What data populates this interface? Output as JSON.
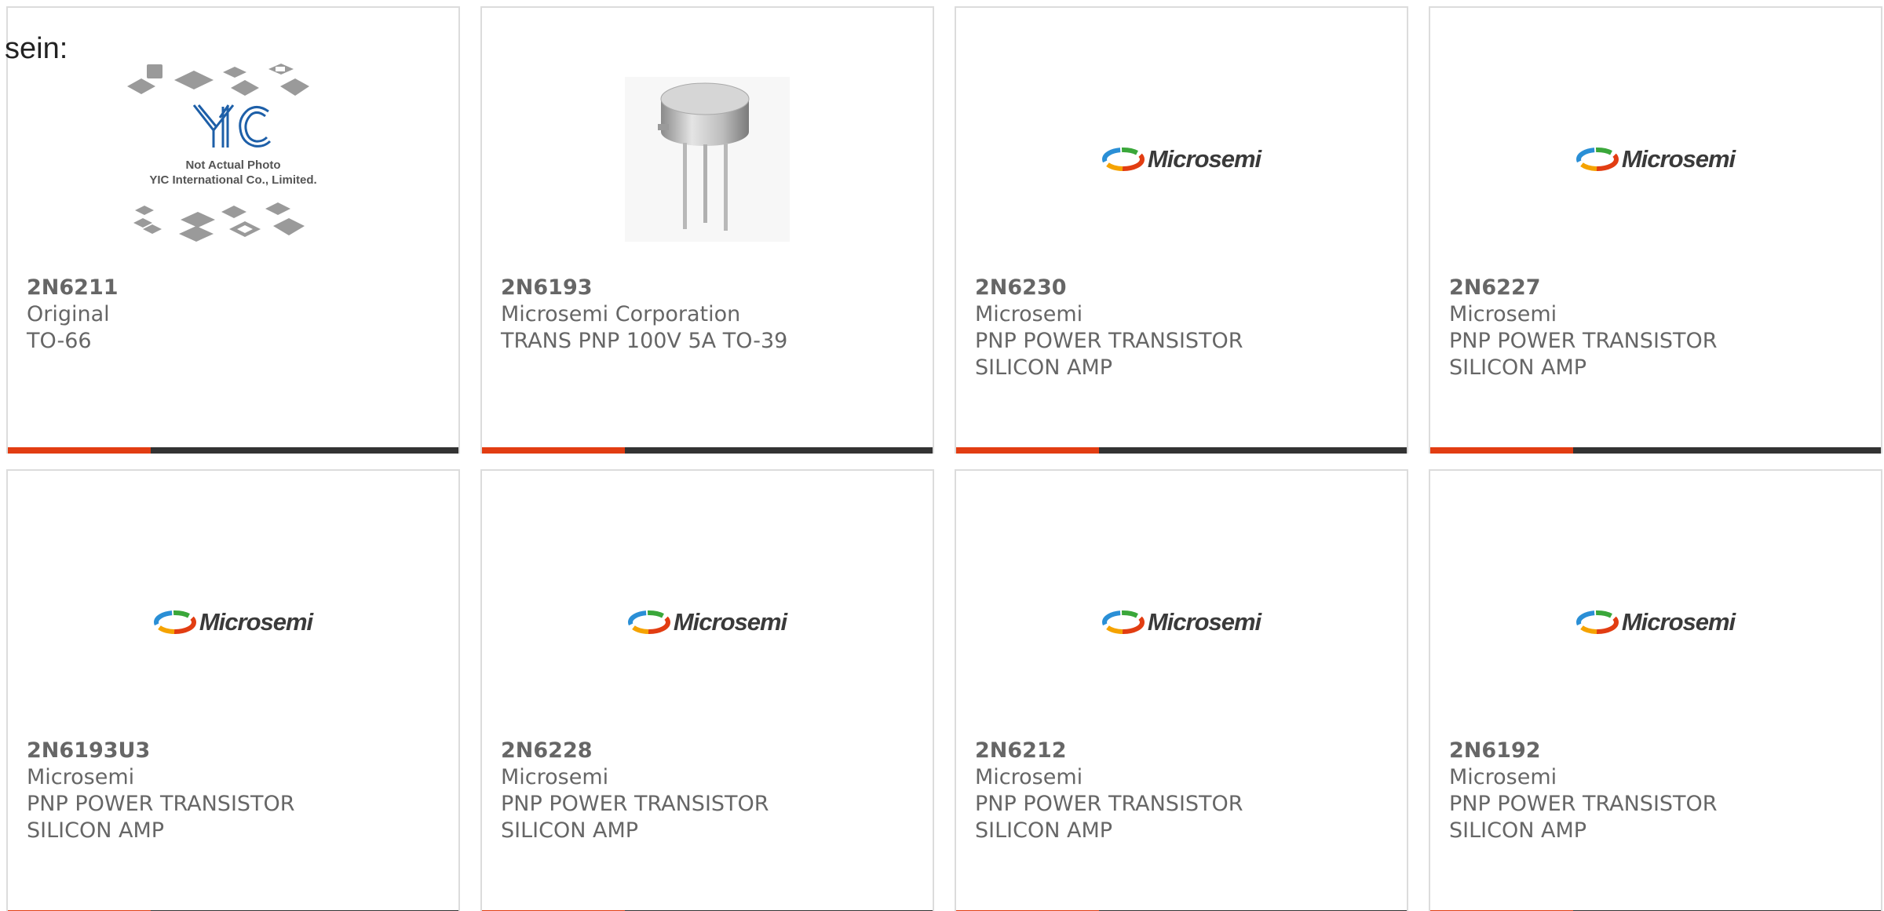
{
  "intro": {
    "text": "sein:"
  },
  "accent_color": "#e23d12",
  "bar_color": "#333333",
  "products": [
    {
      "part": "2N6211",
      "lines": [
        "Original",
        "TO-66"
      ],
      "image": "yic-placeholder",
      "image_text": {
        "logo": "YIC",
        "note1": "Not Actual Photo",
        "note2": "YIC International Co., Limited."
      }
    },
    {
      "part": "2N6193",
      "lines": [
        "Microsemi Corporation",
        "TRANS PNP 100V 5A TO-39"
      ],
      "image": "to39-transistor-photo"
    },
    {
      "part": "2N6230",
      "lines": [
        "Microsemi",
        "PNP POWER TRANSISTOR",
        "SILICON AMP"
      ],
      "image": "microsemi-logo",
      "logo_word": "Microsemi"
    },
    {
      "part": "2N6227",
      "lines": [
        "Microsemi",
        "PNP POWER TRANSISTOR",
        "SILICON AMP"
      ],
      "image": "microsemi-logo",
      "logo_word": "Microsemi"
    },
    {
      "part": "2N6193U3",
      "lines": [
        "Microsemi",
        "PNP POWER TRANSISTOR",
        "SILICON AMP"
      ],
      "image": "microsemi-logo",
      "logo_word": "Microsemi"
    },
    {
      "part": "2N6228",
      "lines": [
        "Microsemi",
        "PNP POWER TRANSISTOR",
        "SILICON AMP"
      ],
      "image": "microsemi-logo",
      "logo_word": "Microsemi"
    },
    {
      "part": "2N6212",
      "lines": [
        "Microsemi",
        "PNP POWER TRANSISTOR",
        "SILICON AMP"
      ],
      "image": "microsemi-logo",
      "logo_word": "Microsemi"
    },
    {
      "part": "2N6192",
      "lines": [
        "Microsemi",
        "PNP POWER TRANSISTOR",
        "SILICON AMP"
      ],
      "image": "microsemi-logo",
      "logo_word": "Microsemi"
    }
  ]
}
